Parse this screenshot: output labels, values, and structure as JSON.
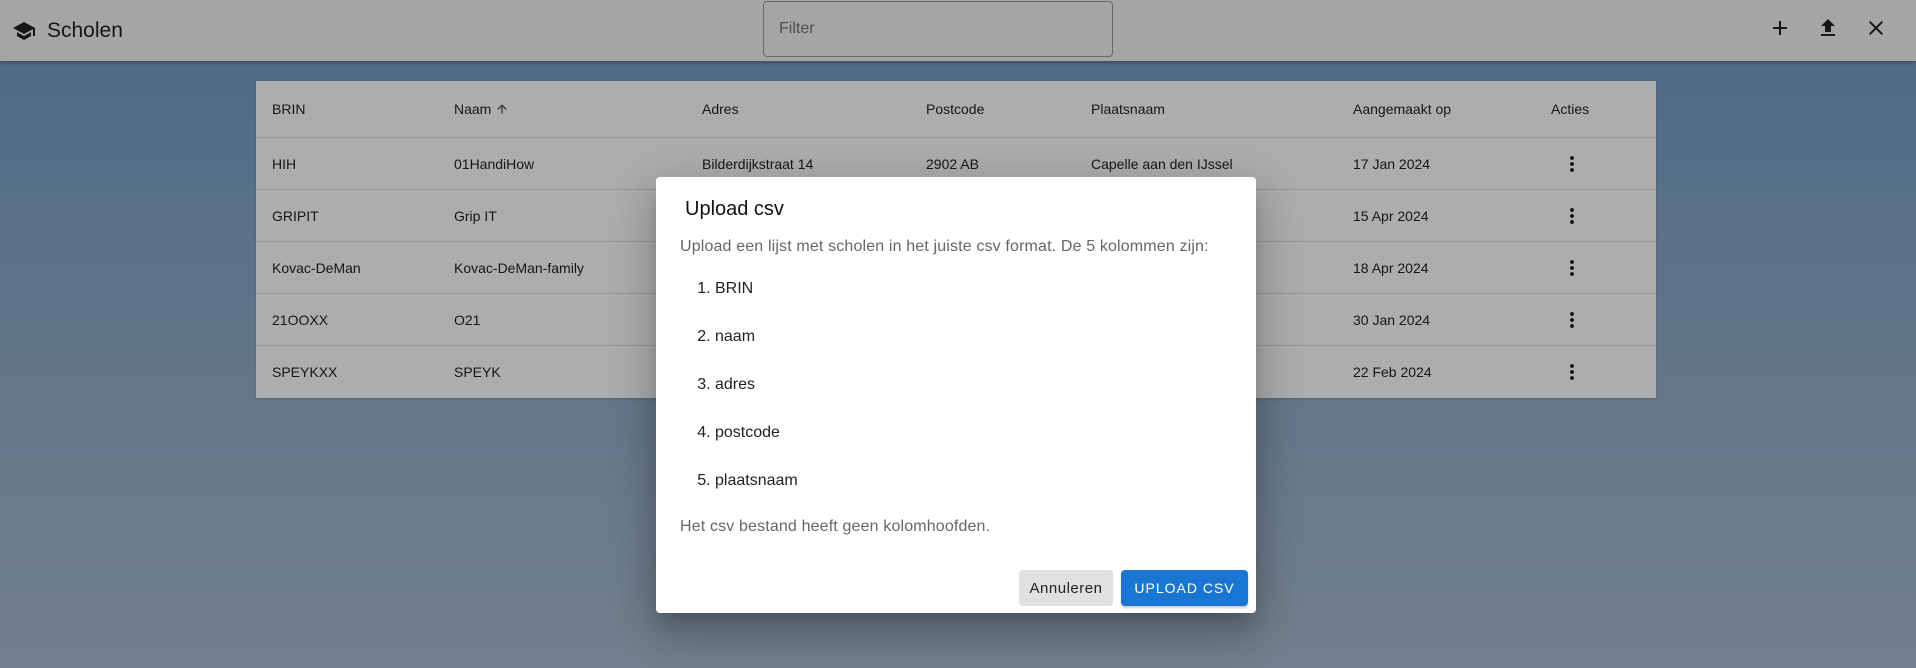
{
  "app": {
    "title": "Scholen",
    "icon": "school-icon"
  },
  "filter": {
    "placeholder": "Filter",
    "value": ""
  },
  "toolbar": {
    "add_icon": "add-icon",
    "upload_icon": "upload-icon",
    "close_icon": "close-icon"
  },
  "table": {
    "columns": [
      "BRIN",
      "Naam",
      "Adres",
      "Postcode",
      "Plaatsnaam",
      "Aangemaakt op",
      "Acties"
    ],
    "sorted_column": "Naam",
    "sort_direction": "ascending",
    "rows": [
      [
        "HIH",
        "01HandiHow",
        "Bilderdijkstraat 14",
        "2902 AB",
        "Capelle aan den IJssel",
        "17 Jan 2024"
      ],
      [
        "GRIPIT",
        "Grip IT",
        "",
        "",
        "",
        "15 Apr 2024"
      ],
      [
        "Kovac-DeMan",
        "Kovac-DeMan-family",
        "",
        "",
        "",
        "18 Apr 2024"
      ],
      [
        "21OOXX",
        "O21",
        "",
        "",
        "",
        "30 Jan 2024"
      ],
      [
        "SPEYKXX",
        "SPEYK",
        "",
        "",
        "",
        "22 Feb 2024"
      ]
    ],
    "row_menu_icon": "more-vert-icon"
  },
  "dialog": {
    "title": "Upload csv",
    "intro": "Upload een lijst met scholen in het juiste csv format. De 5 kolommen zijn:",
    "columns": [
      "BRIN",
      "naam",
      "adres",
      "postcode",
      "plaatsnaam"
    ],
    "note": "Het csv bestand heeft geen kolomhoofden.",
    "cancel_label": "Annuleren",
    "upload_label": "UPLOAD CSV"
  },
  "colors": {
    "primary": "#1976d2",
    "toolbar_bg": "#f4f4f4",
    "backdrop": "rgba(0,0,0,0.32)"
  }
}
